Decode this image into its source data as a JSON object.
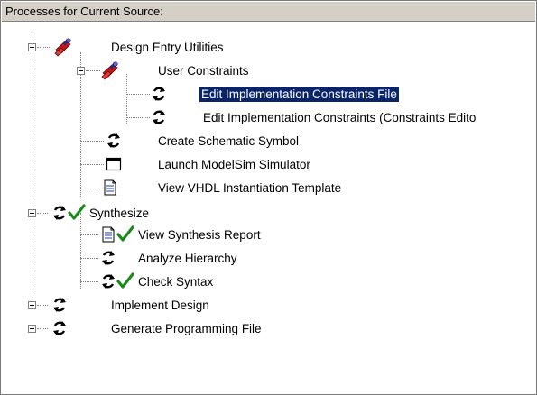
{
  "header": {
    "title": "Processes for Current Source:"
  },
  "items": [
    {
      "label": "Design Entry Utilities",
      "icon": "toolbox-icon"
    },
    {
      "label": "User Constraints",
      "icon": "toolbox-icon"
    },
    {
      "label": "Edit Implementation Constraints File",
      "icon": "process-icon",
      "selected": true
    },
    {
      "label": "Edit Implementation Constraints (Constraints Edito",
      "icon": "process-icon"
    },
    {
      "label": "Create Schematic Symbol",
      "icon": "process-icon"
    },
    {
      "label": "Launch ModelSim Simulator",
      "icon": "window-icon"
    },
    {
      "label": "View VHDL Instantiation Template",
      "icon": "document-icon"
    },
    {
      "label": "Synthesize",
      "icon": "process-icon",
      "status": "check-icon"
    },
    {
      "label": "View Synthesis Report",
      "icon": "document-icon",
      "status": "check-icon"
    },
    {
      "label": "Analyze Hierarchy",
      "icon": "process-icon"
    },
    {
      "label": "Check Syntax",
      "icon": "process-icon",
      "status": "check-icon"
    },
    {
      "label": "Implement Design",
      "icon": "process-icon"
    },
    {
      "label": "Generate Programming File",
      "icon": "process-icon"
    }
  ]
}
